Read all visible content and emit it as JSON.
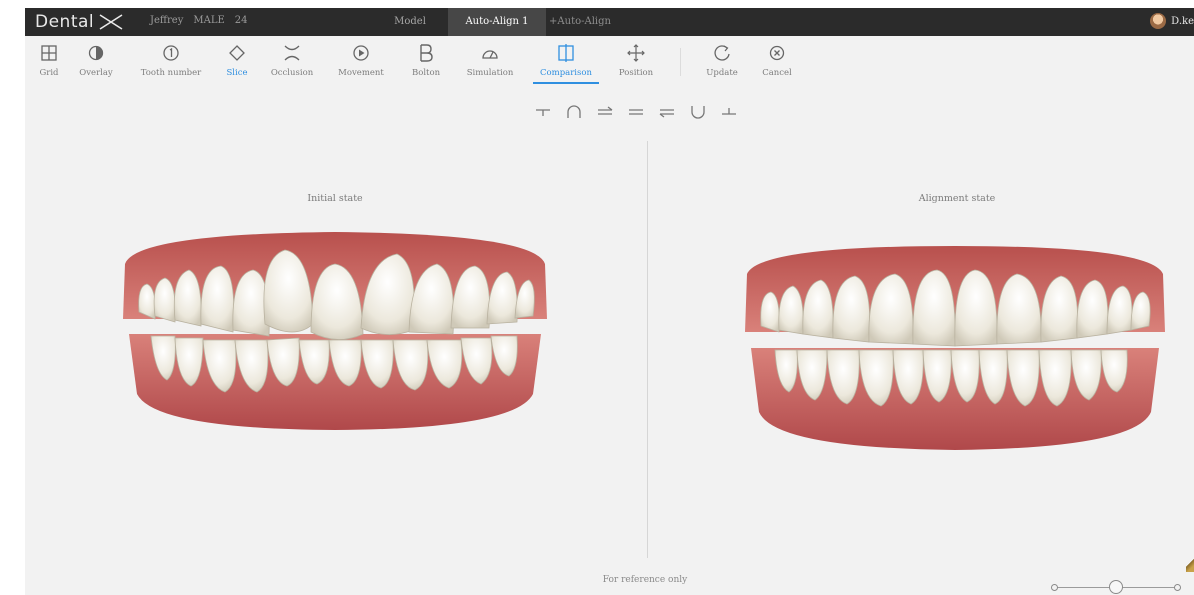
{
  "header": {
    "logo_text": "Dental",
    "patient": {
      "name": "Jeffrey",
      "sex": "MALE",
      "age": "24"
    },
    "tabs": [
      {
        "label": "Model",
        "active": false
      },
      {
        "label": "Auto-Align 1",
        "active": true
      },
      {
        "label": "+Auto-Align",
        "active": false
      }
    ],
    "user_name": "D.ke"
  },
  "toolbar": {
    "tools": [
      {
        "label": "Grid",
        "icon": "grid-icon"
      },
      {
        "label": "Overlay",
        "icon": "overlay-icon"
      },
      {
        "label": "Tooth number",
        "icon": "tooth-number-icon"
      },
      {
        "label": "Slice",
        "icon": "slice-icon",
        "selected": true
      },
      {
        "label": "Occlusion",
        "icon": "occlusion-icon"
      },
      {
        "label": "Movement",
        "icon": "movement-icon"
      },
      {
        "label": "Bolton",
        "icon": "bolton-icon"
      },
      {
        "label": "Simulation",
        "icon": "simulation-icon"
      },
      {
        "label": "Comparison",
        "icon": "comparison-icon",
        "selected": true
      },
      {
        "label": "Position",
        "icon": "position-icon"
      },
      {
        "label": "Update",
        "icon": "update-icon"
      },
      {
        "label": "Cancel",
        "icon": "cancel-icon"
      }
    ],
    "accent_color": "#2f8fe0"
  },
  "view_controls": [
    "upper-jaw-view-icon",
    "upper-arch-icon",
    "upper-align-icon",
    "both-jaws-icon",
    "lower-align-icon",
    "lower-arch-icon",
    "lower-jaw-view-icon"
  ],
  "panels": {
    "left_title": "Initial state",
    "right_title": "Alignment state"
  },
  "footer": {
    "note": "For reference only"
  },
  "colors": {
    "topbar": "#2b2b2b",
    "canvas": "#f2f2f2",
    "gum": "#c8625e",
    "tooth": "#f2efe6"
  }
}
